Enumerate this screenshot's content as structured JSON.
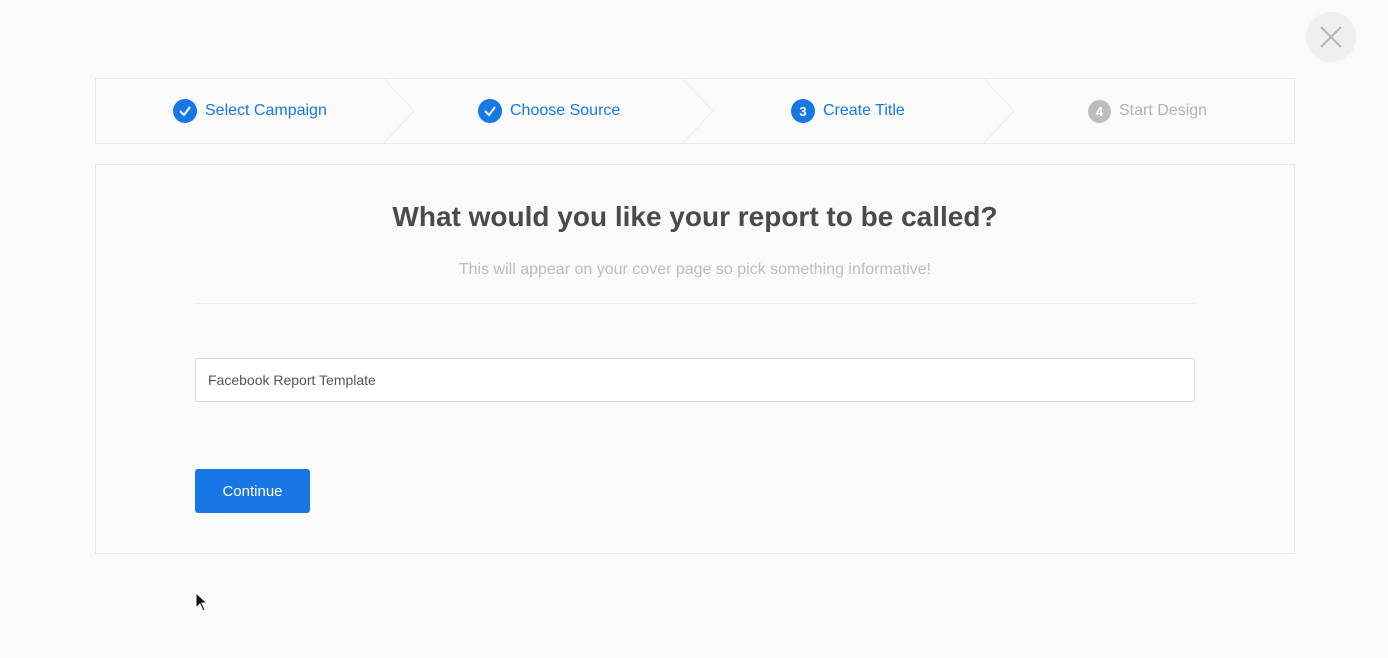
{
  "close": {
    "label": "×"
  },
  "steps": [
    {
      "label": "Select Campaign",
      "state": "done",
      "number": ""
    },
    {
      "label": "Choose Source",
      "state": "done",
      "number": ""
    },
    {
      "label": "Create Title",
      "state": "current",
      "number": "3"
    },
    {
      "label": "Start Design",
      "state": "upcoming",
      "number": "4"
    }
  ],
  "form": {
    "heading": "What would you like your report to be called?",
    "subheading": "This will appear on your cover page so pick something informative!",
    "title_value": "Facebook Report Template",
    "continue_label": "Continue"
  },
  "colors": {
    "accent": "#1677e5",
    "inactive": "#bdbdbd",
    "heading": "#4a4a4a"
  }
}
